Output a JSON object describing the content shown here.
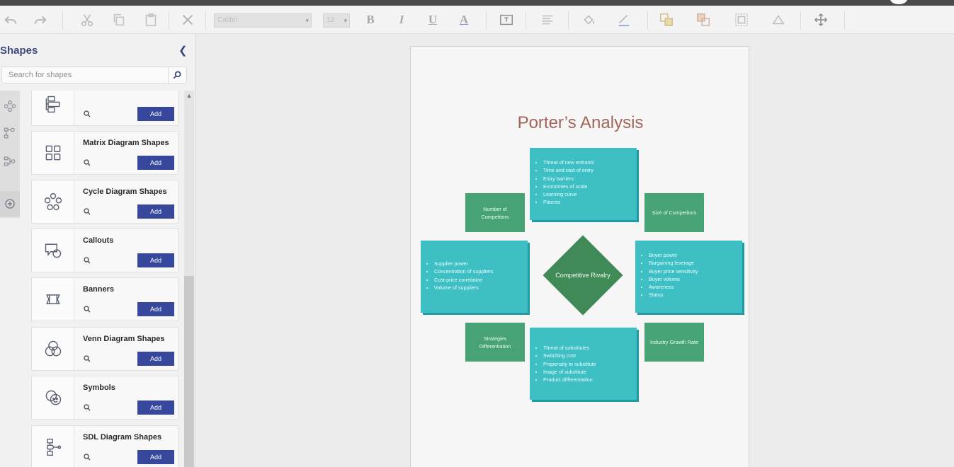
{
  "toolbar": {
    "font_name": "Calibri",
    "font_size": "12",
    "bold": "B",
    "italic": "I",
    "underline": "U",
    "font_color": "A"
  },
  "panel": {
    "title": "Shapes",
    "search_placeholder": "Search for shapes",
    "add_label": "Add",
    "items": [
      {
        "name": ""
      },
      {
        "name": "Matrix Diagram Shapes"
      },
      {
        "name": "Cycle Diagram Shapes"
      },
      {
        "name": "Callouts"
      },
      {
        "name": "Banners"
      },
      {
        "name": "Venn Diagram Shapes"
      },
      {
        "name": "Symbols"
      },
      {
        "name": "SDL Diagram Shapes"
      }
    ]
  },
  "diagram": {
    "title": "Porter’s Analysis",
    "center": "Competitive Rivalry",
    "top_list": [
      "Threat of new entrants",
      "Time and cost of entry",
      "Entry barriers",
      "Economies of scale",
      "Learning curve",
      "Patents"
    ],
    "left_list": [
      "Supplier power",
      "Concentration of suppliers",
      "Cost-price correlation",
      "Volume of suppliers"
    ],
    "right_list": [
      "Buyer power",
      "Bargaining leverage",
      "Buyer price sensitivity",
      "Buyer volume",
      "Awareness",
      "Status"
    ],
    "bottom_list": [
      "Threat of substitutes",
      "Switching cost",
      "Propensity to substitute",
      "Image of substitute",
      "Product differentiation"
    ],
    "corner_tl": "Number of Competitors",
    "corner_tr": "Size of Competitors",
    "corner_bl": "Strategies Differentiation",
    "corner_br": "Industry Growth Rate"
  },
  "colors": {
    "accent": "#36479c",
    "teal": "#3dbfc4",
    "green": "#47a276",
    "diamond": "#3f8a57",
    "title": "#a2655a"
  }
}
